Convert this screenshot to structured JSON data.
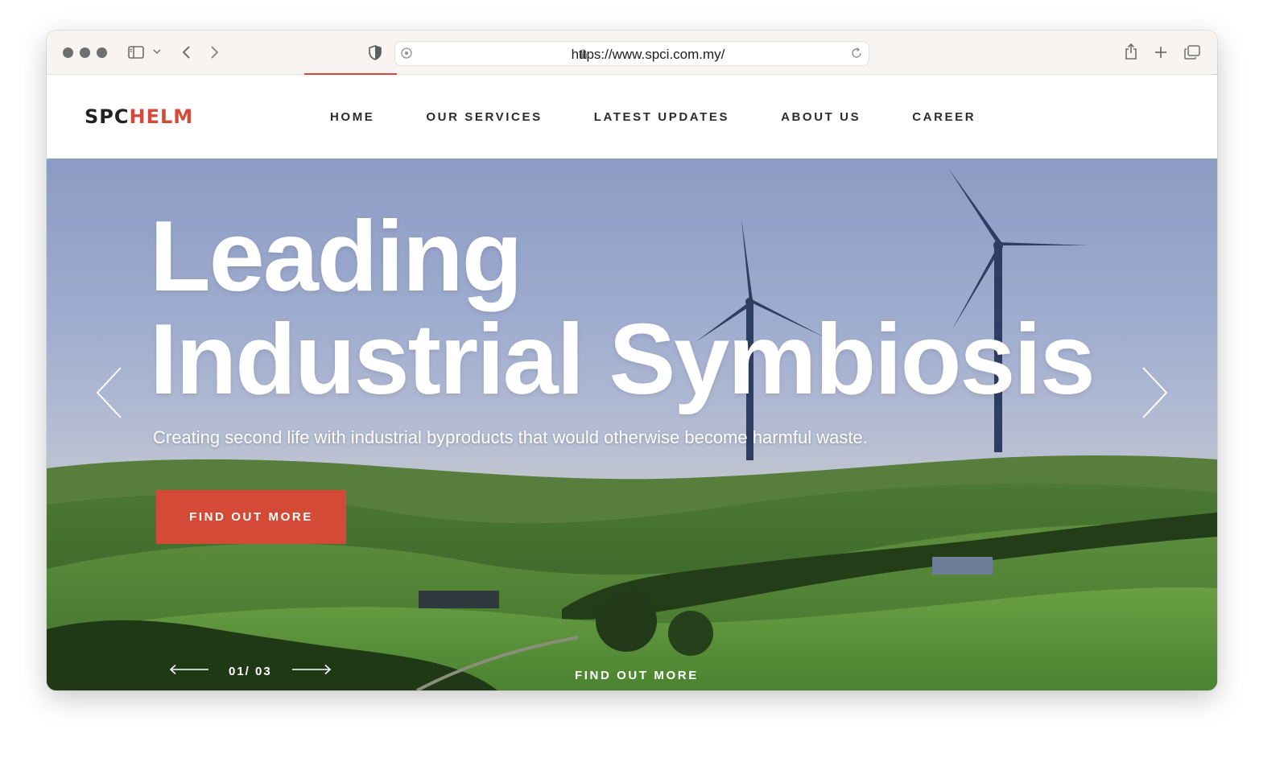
{
  "browser": {
    "url": "https://www.spci.com.my/",
    "icons": {
      "sidebar": "sidebar-icon",
      "back": "chevron-left-icon",
      "forward": "chevron-right-icon",
      "privacy": "shield-icon",
      "lock": "lock-icon",
      "reload": "reload-icon",
      "share": "share-icon",
      "new_tab": "plus-icon",
      "tabs": "tabs-overview-icon"
    }
  },
  "site": {
    "logo": {
      "part1": "SPC",
      "part2": "HELM"
    },
    "nav": [
      {
        "label": "HOME"
      },
      {
        "label": "OUR SERVICES"
      },
      {
        "label": "LATEST UPDATES"
      },
      {
        "label": "ABOUT US"
      },
      {
        "label": "CAREER"
      }
    ],
    "accent_color": "#d44a36"
  },
  "hero": {
    "title_line1": "Leading",
    "title_line2": "Industrial Symbiosis",
    "subtitle": "Creating second life with industrial byproducts that would otherwise become harmful waste.",
    "cta_label": "FIND OUT MORE",
    "counter": "01/ 03",
    "bottom_link": "FIND OUT MORE"
  }
}
